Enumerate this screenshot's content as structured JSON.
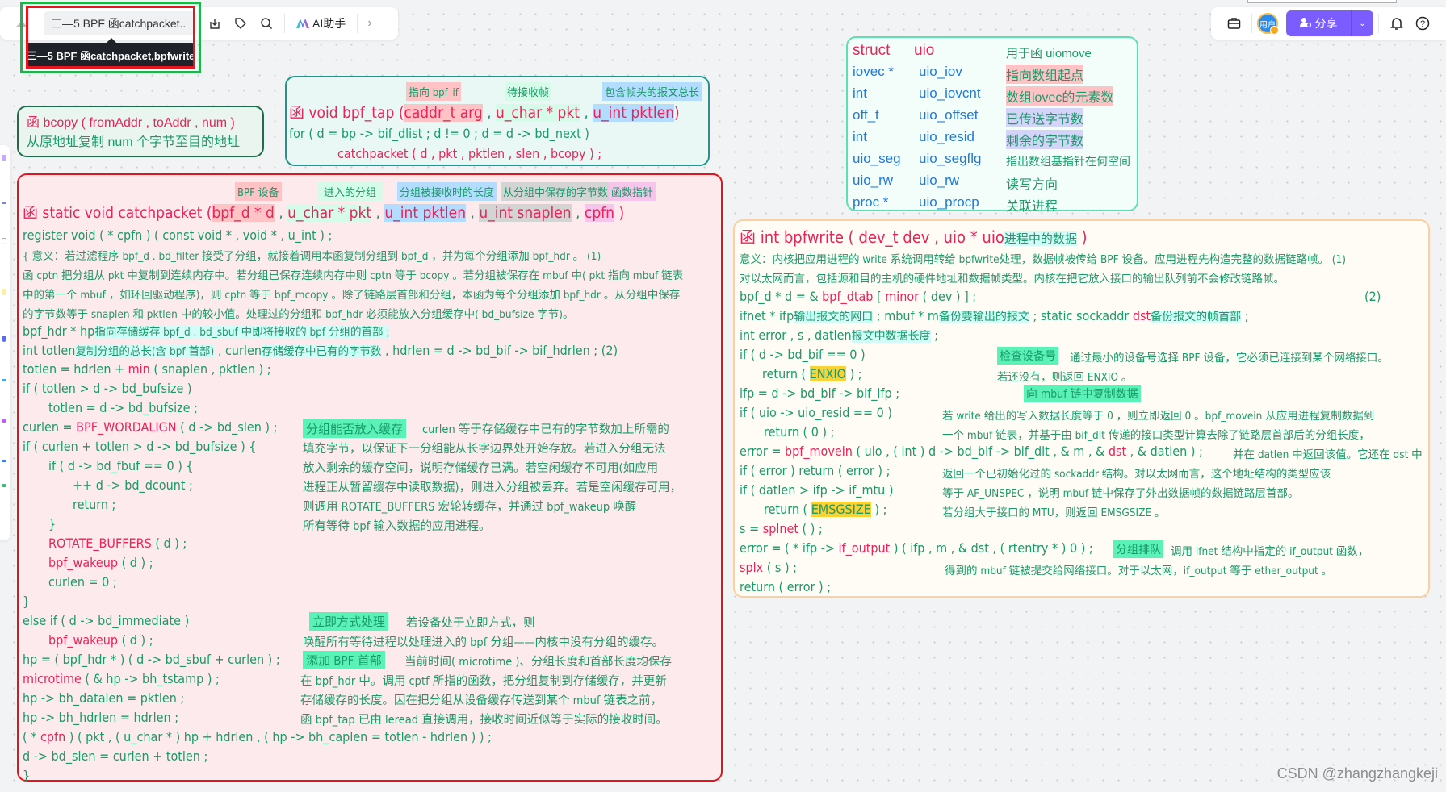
{
  "toolbar_left": {
    "doc_title": "三—5 BPF 函catchpacket..",
    "tooltip": "三—5 BPF 函catchpacket,bpfwrite",
    "ai_label": "AI助手"
  },
  "toolbar_right": {
    "avatar_text": "用户",
    "share_label": "分享"
  },
  "bcopy": {
    "line1": "函   bcopy ( fromAddr , toAddr , num )",
    "line2": "从原地址复制 num 个字节至目的地址"
  },
  "bpf_tap": {
    "notes": [
      "指向 bpf_if",
      "待接收帧",
      "包含帧头的报文总长"
    ],
    "sig_prefix": "函  void   bpf_tap (",
    "params": [
      "caddr_t  arg",
      "u_char * pkt",
      "u_int   pktlen"
    ],
    "sig_suffix": ")",
    "line2": "for ( d = bp -> bif_dlist ; d != 0 ; d = d -> bd_next )",
    "line3": "catchpacket ( d , pkt , pktlen , slen , bcopy ) ;"
  },
  "catchpacket": {
    "notes": [
      "BPF 设备",
      "进入的分组",
      "分组被接收时的长度",
      "从分组中保存的字节数",
      "函数指针"
    ],
    "sig_prefix": "函   static   void   catchpacket (",
    "params": [
      "bpf_d  *  d",
      "u_char *  pkt",
      "u_int   pktlen",
      "u_int   snaplen",
      "cpfn"
    ],
    "sig_suffix": " )",
    "register_line": " register  void  ( * cpfn ) ( const   void * , void * , u_int ) ;",
    "meaning": [
      "{ 意义：若过滤程序 bpf_d . bd_filter 接受了分组，就接着调用本函复制分组到 bpf_d ，并为每个分组添加 bpf_hdr 。     (1)",
      "函 cptn 把分组从 pkt 中复制到连续内存中。若分组已保存连续内存中则 cptn 等于 bcopy 。若分组被保存在 mbuf 中( pkt 指向 mbuf 链表",
      "中的第一个 mbuf ，如环回驱动程序)，则 cptn 等于 bpf_mcopy 。除了链路层首部和分组，本函为每个分组添加 bpf_hdr 。从分组中保存",
      "的字节数等于 snaplen 和 pktlen 中的较小值。处理过的分组和 bpf_hdr 必须能放入分组缓存中( bd_bufsize 字节)。"
    ],
    "hp_line": {
      "code": "bpf_hdr  *  hp",
      "note": "指向存储缓存 bpf_d . bd_sbuf 中即将接收的 bpf 分组的首部 ;"
    },
    "int_line": {
      "a": "int   totlen",
      "a_note": "复制分组的总长(含 bpf 首部)",
      "b": " , curlen",
      "b_note": "存储缓存中已有的字节数",
      "c": " , hdrlen  =  d -> bd_bif -> bif_hdrlen ;     (2)"
    },
    "totlen_line": {
      "pre": "totlen  =  hdrlen  +  ",
      "fn": "min",
      "post": " ( snaplen , pktlen ) ;"
    },
    "code_lines": [
      "if ( totlen  >  d -> bd_bufsize )",
      "totlen  =  d -> bd_bufsize ;"
    ],
    "curlen_line": {
      "pre": "curlen  =  ",
      "fn": "BPF_WORDALIGN",
      "post": " ( d -> bd_slen ) ;"
    },
    "block1": [
      "if ( curlen  +  totlen  >  d -> bd_bufsize ) {",
      "if ( d -> bd_fbuf  ==  0 ) {",
      "++ d -> bd_dcount ;",
      "return ;",
      "}"
    ],
    "rotate": "ROTATE_BUFFERS",
    "rotate_args": " ( d ) ;",
    "wakeup": "bpf_wakeup",
    "wakeup_args": " ( d ) ;",
    "curlen0": "curlen  =  0 ;",
    "close_brace": "}",
    "note1_tag": "分组能否放入缓存",
    "note1_lines": [
      "curlen 等于存储缓存中已有的字节数加上所需的",
      "填充字节，以保证下一分组能从长字边界处开始存放。若进入分组无法",
      "放入剩余的缓存空间，说明存储缓存已满。若空闲缓存不可用(如应用",
      "进程正从暂留缓存中读取数据)，则进入分组被丢弃。若是空闲缓存可用，",
      "则调用 ROTATE_BUFFERS 宏轮转缓存，并通过 bpf_wakeup 唤醒",
      "所有等待 bpf 输入数据的应用进程。"
    ],
    "else_line": "else  if ( d -> bd_immediate )",
    "note2_tag": "立即方式处理",
    "note2_lines": [
      "若设备处于立即方式，则",
      "唤醒所有等待进程以处理进入的 bpf 分组——内核中没有分组的缓存。"
    ],
    "hp_assign": "hp  =  ( bpf_hdr * ) ( d -> bd_sbuf  +  curlen ) ;",
    "microtime": "microtime",
    "microtime_args": " ( & hp -> bh_tstamp ) ;",
    "datalen": "hp -> bh_datalen  =  pktlen ;",
    "hdrlen": "hp -> bh_hdrlen    =  hdrlen ;",
    "cpfn_call": {
      "pre": "( * ",
      "fn": "cpfn",
      "post": " ) ( pkt , ( u_char * ) hp  +  hdrlen , ( hp -> bh_caplen  =  totlen  -  hdrlen ) ) ;"
    },
    "slen": "d -> bd_slen  =  curlen  +  totlen ;",
    "end_brace": "}",
    "note3_tag": "添加 BPF 首部",
    "note3_lines": [
      "当前时间( microtime )、分组长度和首部长度均保存",
      "在 bpf_hdr 中。调用 cptf 所指的函数，把分组复制到存储缓存，并更新",
      "存储缓存的长度。因在把分组从设备缓存传送到某个 mbuf 链表之前，",
      "函 bpf_tap 已由 leread 直接调用，接收时间近似等于实际的接收时间。"
    ]
  },
  "struct_uio": {
    "title": [
      "struct",
      "uio"
    ],
    "title_note": "用于函 uiomove",
    "fields": [
      {
        "type": "iovec  *",
        "name": "uio_iov",
        "note": "指向数组起点",
        "hl": "pink"
      },
      {
        "type": "int",
        "name": "uio_iovcnt",
        "note": "数组iovec的元素数",
        "hl": "pink"
      },
      {
        "type": "off_t",
        "name": "uio_offset",
        "note": "已传送字节数",
        "hl": "lav"
      },
      {
        "type": "int",
        "name": "uio_resid",
        "note": "剩余的字节数",
        "hl": "lav"
      },
      {
        "type": "uio_seg",
        "name": "uio_segflg",
        "note": "指出数组基指针在何空间",
        "hl": ""
      },
      {
        "type": "uio_rw",
        "name": "uio_rw",
        "note": "读写方向",
        "hl": ""
      },
      {
        "type": "proc   *",
        "name": "uio_procp",
        "note": "关联进程",
        "hl": ""
      }
    ]
  },
  "bpfwrite": {
    "sig": "函      int    bpfwrite ( dev_t   dev , uio *  uio",
    "sig_note": "进程中的数据",
    "sig_end": " )",
    "meaning": [
      "意义：内核把应用进程的 write 系统调用转给 bpfwrite处理，数据帧被传给 BPF 设备。应用进程先构造完整的数据链路帧。   (1)",
      "对以太网而言，包括源和目的主机的硬件地址和数据帧类型。内核在把它放入接口的输出队列前不会修改链路帧。"
    ],
    "d_line": {
      "pre": "bpf_d  *  d  =  & ",
      "fn": "bpf_dtab",
      "mid": " [ ",
      "fn2": "minor",
      "post": " ( dev ) ] ;",
      "num": "(2)"
    },
    "ifnet_line": {
      "a": "ifnet *  ifp",
      "a_note": "输出报文的网口",
      "b": " ;          mbuf *  m",
      "b_note": "备份要输出的报文",
      "c": " ;          static   sockaddr   ",
      "c_fn": "dst",
      "c_note": "备份报文的帧首部",
      "end": " ;"
    },
    "int_line": {
      "code": "int   error , s , datlen",
      "note": "报文中数据长度",
      "end": " ;"
    },
    "if_bif": "if ( d -> bd_bif  ==  0 )",
    "note_check_tag": "检查设备号",
    "note_check": "通过最小的设备号选择 BPF 设备，它必须已连接到某个网络接口。",
    "return_enxio": {
      "pre": "return ( ",
      "val": "ENXIO",
      "post": " ) ;"
    },
    "note_enxio": "若还没有，则返回 ENXIO 。",
    "ifp_line": "ifp  =  d -> bd_bif -> bif_ifp ;",
    "note_copy_tag": "向 mbuf 链中复制数据",
    "if_resid": "if ( uio -> uio_resid  ==  0 )",
    "return0": "return   ( 0 ) ;",
    "error_line": {
      "pre": "error  =  ",
      "fn": "bpf_movein",
      "mid": " ( uio , ( int ) d -> bd_bif -> bif_dlt , & m , & ",
      "fn2": "dst",
      "post": " , & datlen ) ;"
    },
    "if_error": "if ( error )        return ( error ) ;",
    "if_datlen": "if ( datlen  >  ifp -> if_mtu )",
    "return_emsg": {
      "pre": "return ( ",
      "val": "EMSGSIZE",
      "post": " ) ;"
    },
    "splnet": {
      "pre": "s  =  ",
      "fn": "splnet",
      "post": " ( ) ;"
    },
    "output_line": {
      "pre": "error  =  ( * ifp -> ",
      "fn": "if_output",
      "post": " ) ( ifp , m ,  & dst , ( rtentry * ) 0 ) ;"
    },
    "splx": {
      "fn": "splx",
      "post": " ( s ) ;"
    },
    "return_err": "return   ( error ) ;",
    "note_movein": [
      "若 write 给出的写入数据长度等于 0 ，则立即返回 0 。bpf_movein 从应用进程复制数据到",
      "一个 mbuf 链表，并基于由 bif_dlt 传递的接口类型计算去除了链路层首部后的分组长度，",
      "并在 datlen 中返回该值。它还在 dst 中",
      "返回一个已初始化过的 sockaddr 结构。对以太网而言，这个地址结构的类型应该",
      "等于 AF_UNSPEC ，说明 mbuf 链中保存了外出数据帧的数据链路层首部。",
      "若分组大于接口的 MTU，则返回 EMSGSIZE 。"
    ],
    "note_queue_tag": "分组排队",
    "note_queue": "调用 ifnet 结构中指定的 if_output 函数，",
    "note_queue2": "得到的 mbuf 链被提交给网络接口。对于以太网，if_output 等于 ether_output 。"
  },
  "watermark": "CSDN @zhangzhangkeji"
}
